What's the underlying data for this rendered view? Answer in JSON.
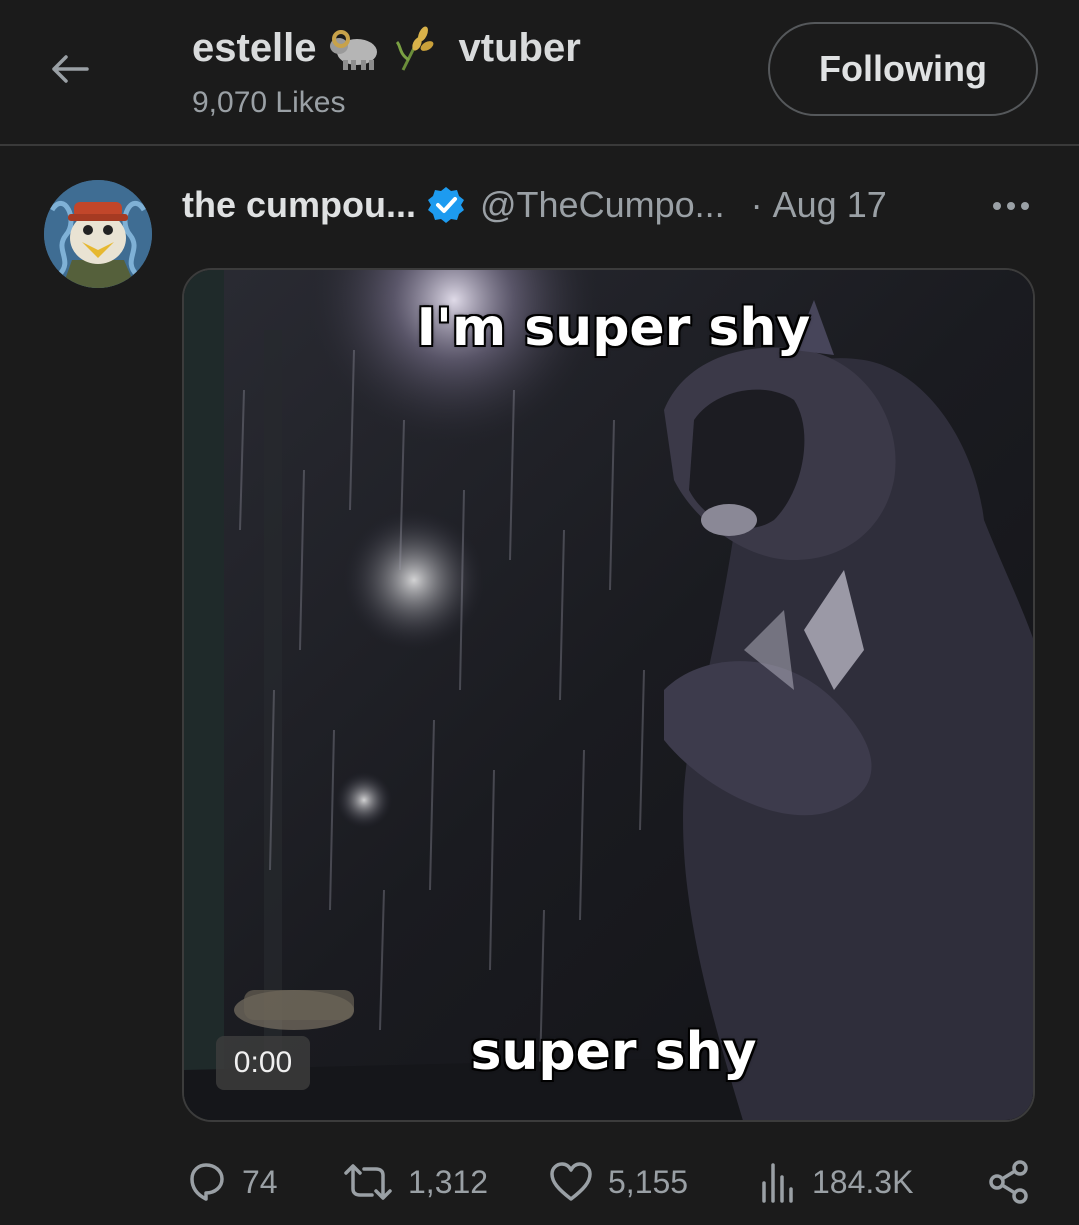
{
  "header": {
    "title": "estelle",
    "title_emojis": [
      "ram-emoji",
      "wheat-emoji"
    ],
    "title_suffix": "vtuber",
    "subtitle": "9,070 Likes",
    "follow_button": "Following"
  },
  "tweet": {
    "author_name": "the cumpou...",
    "verified": true,
    "handle": "@TheCumpo...",
    "date": "Aug 17",
    "media": {
      "caption_top": "I'm super shy",
      "caption_bottom": "super shy",
      "timestamp": "0:00"
    },
    "stats": {
      "replies": "74",
      "reposts": "1,312",
      "likes": "5,155",
      "views": "184.3K"
    }
  },
  "colors": {
    "background": "#1b1b1b",
    "verified_blue": "#1d9bf0",
    "muted_text": "#9aa0a5"
  }
}
